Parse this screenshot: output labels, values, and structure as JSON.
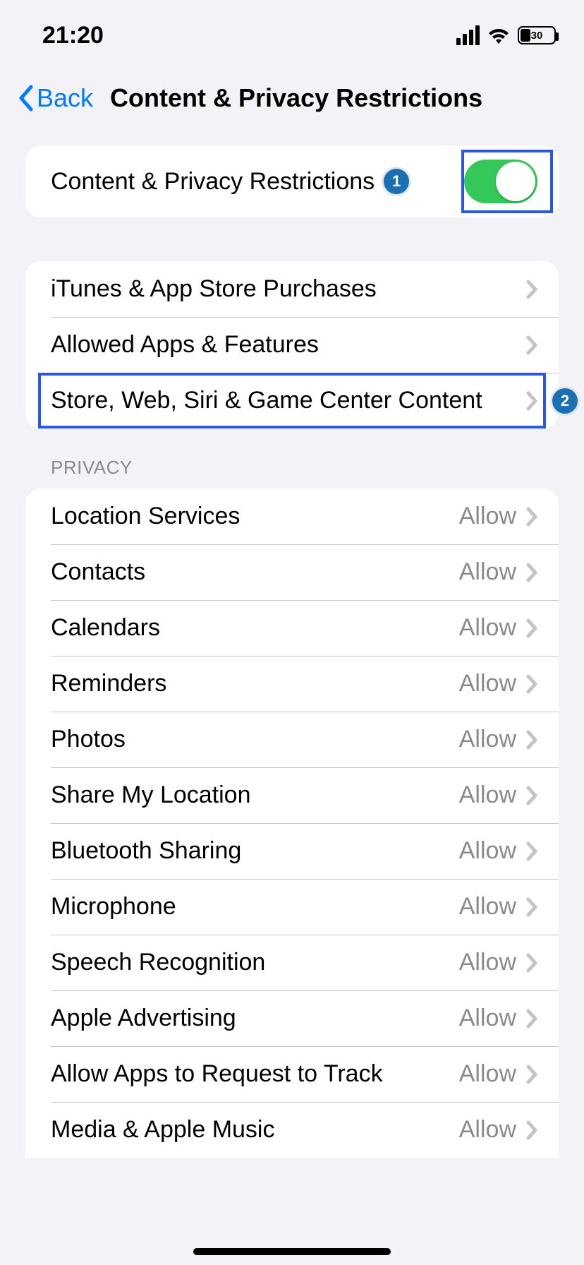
{
  "status": {
    "time": "21:20",
    "battery_pct": "30"
  },
  "nav": {
    "back": "Back",
    "title": "Content & Privacy Restrictions"
  },
  "toggle_row": {
    "label": "Content & Privacy Restrictions",
    "on": true
  },
  "annotations": {
    "badge1": "1",
    "badge2": "2"
  },
  "content_group": [
    {
      "label": "iTunes & App Store Purchases"
    },
    {
      "label": "Allowed Apps & Features"
    },
    {
      "label": "Store, Web, Siri & Game Center Content"
    }
  ],
  "privacy_header": "PRIVACY",
  "privacy_items": [
    {
      "label": "Location Services",
      "value": "Allow"
    },
    {
      "label": "Contacts",
      "value": "Allow"
    },
    {
      "label": "Calendars",
      "value": "Allow"
    },
    {
      "label": "Reminders",
      "value": "Allow"
    },
    {
      "label": "Photos",
      "value": "Allow"
    },
    {
      "label": "Share My Location",
      "value": "Allow"
    },
    {
      "label": "Bluetooth Sharing",
      "value": "Allow"
    },
    {
      "label": "Microphone",
      "value": "Allow"
    },
    {
      "label": "Speech Recognition",
      "value": "Allow"
    },
    {
      "label": "Apple Advertising",
      "value": "Allow"
    },
    {
      "label": "Allow Apps to Request to Track",
      "value": "Allow"
    },
    {
      "label": "Media & Apple Music",
      "value": "Allow"
    }
  ]
}
